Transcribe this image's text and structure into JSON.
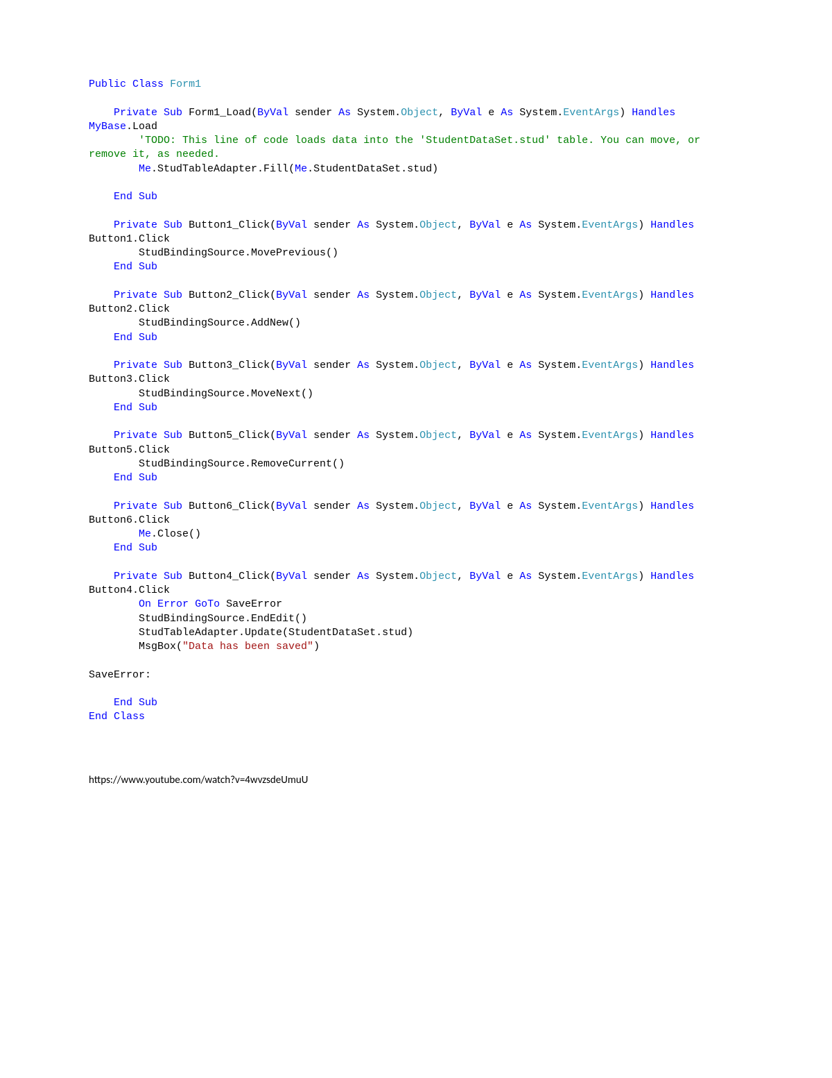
{
  "code": {
    "kw_public": "Public",
    "kw_class": "Class",
    "classname": "Form1",
    "kw_private": "Private",
    "kw_sub": "Sub",
    "kw_byval": "ByVal",
    "kw_as": "As",
    "kw_handles": "Handles",
    "kw_end": "End",
    "kw_me": "Me",
    "kw_on": "On",
    "kw_error": "Error",
    "kw_goto": "GoTo",
    "kw_mybase": "MyBase",
    "t_object": "Object",
    "t_eventargs": "EventArgs",
    "sig_sender": " sender ",
    "sig_e": " e ",
    "sig_sys1": " System.",
    "sig_sys2": " System.",
    "p_open": "(",
    "p_close": ")",
    "comma": ", ",
    "sub_form_load": " Form1_Load(",
    "handles_load": " ",
    "handles_load_txt": ".Load",
    "comment_todo": "'TODO: This line of code loads data into the 'StudentDataSet.stud' table. You can move, or remove it, as needed.",
    "fill_line": ".StudTableAdapter.Fill(",
    "fill_arg_suffix": ".StudentDataSet.stud)",
    "sub_btn1": " Button1_Click(",
    "handles_btn1": " Button1.Click",
    "body_btn1": "StudBindingSource.MovePrevious()",
    "sub_btn2": " Button2_Click(",
    "handles_btn2": " Button2.Click",
    "body_btn2": "StudBindingSource.AddNew()",
    "sub_btn3": " Button3_Click(",
    "handles_btn3": " Button3.Click",
    "body_btn3": "StudBindingSource.MoveNext()",
    "sub_btn5": " Button5_Click(",
    "handles_btn5": " Button5.Click",
    "body_btn5": "StudBindingSource.RemoveCurrent()",
    "sub_btn6": " Button6_Click(",
    "handles_btn6": " Button6.Click",
    "body_btn6_suffix": ".Close()",
    "sub_btn4": " Button4_Click(",
    "handles_btn4": " Button4.Click",
    "body_btn4_goto_suffix": " SaveError",
    "body_btn4_line2": "StudBindingSource.EndEdit()",
    "body_btn4_line3": "StudTableAdapter.Update(StudentDataSet.stud)",
    "body_btn4_msg_prefix": "MsgBox(",
    "body_btn4_msg_str": "\"Data has been saved\"",
    "body_btn4_msg_suffix": ")",
    "label_saveerror": "SaveError:",
    "end_sub": " Sub",
    "end_class": " Class"
  },
  "footer": {
    "url": "https://www.youtube.com/watch?v=4wvzsdeUmuU"
  }
}
